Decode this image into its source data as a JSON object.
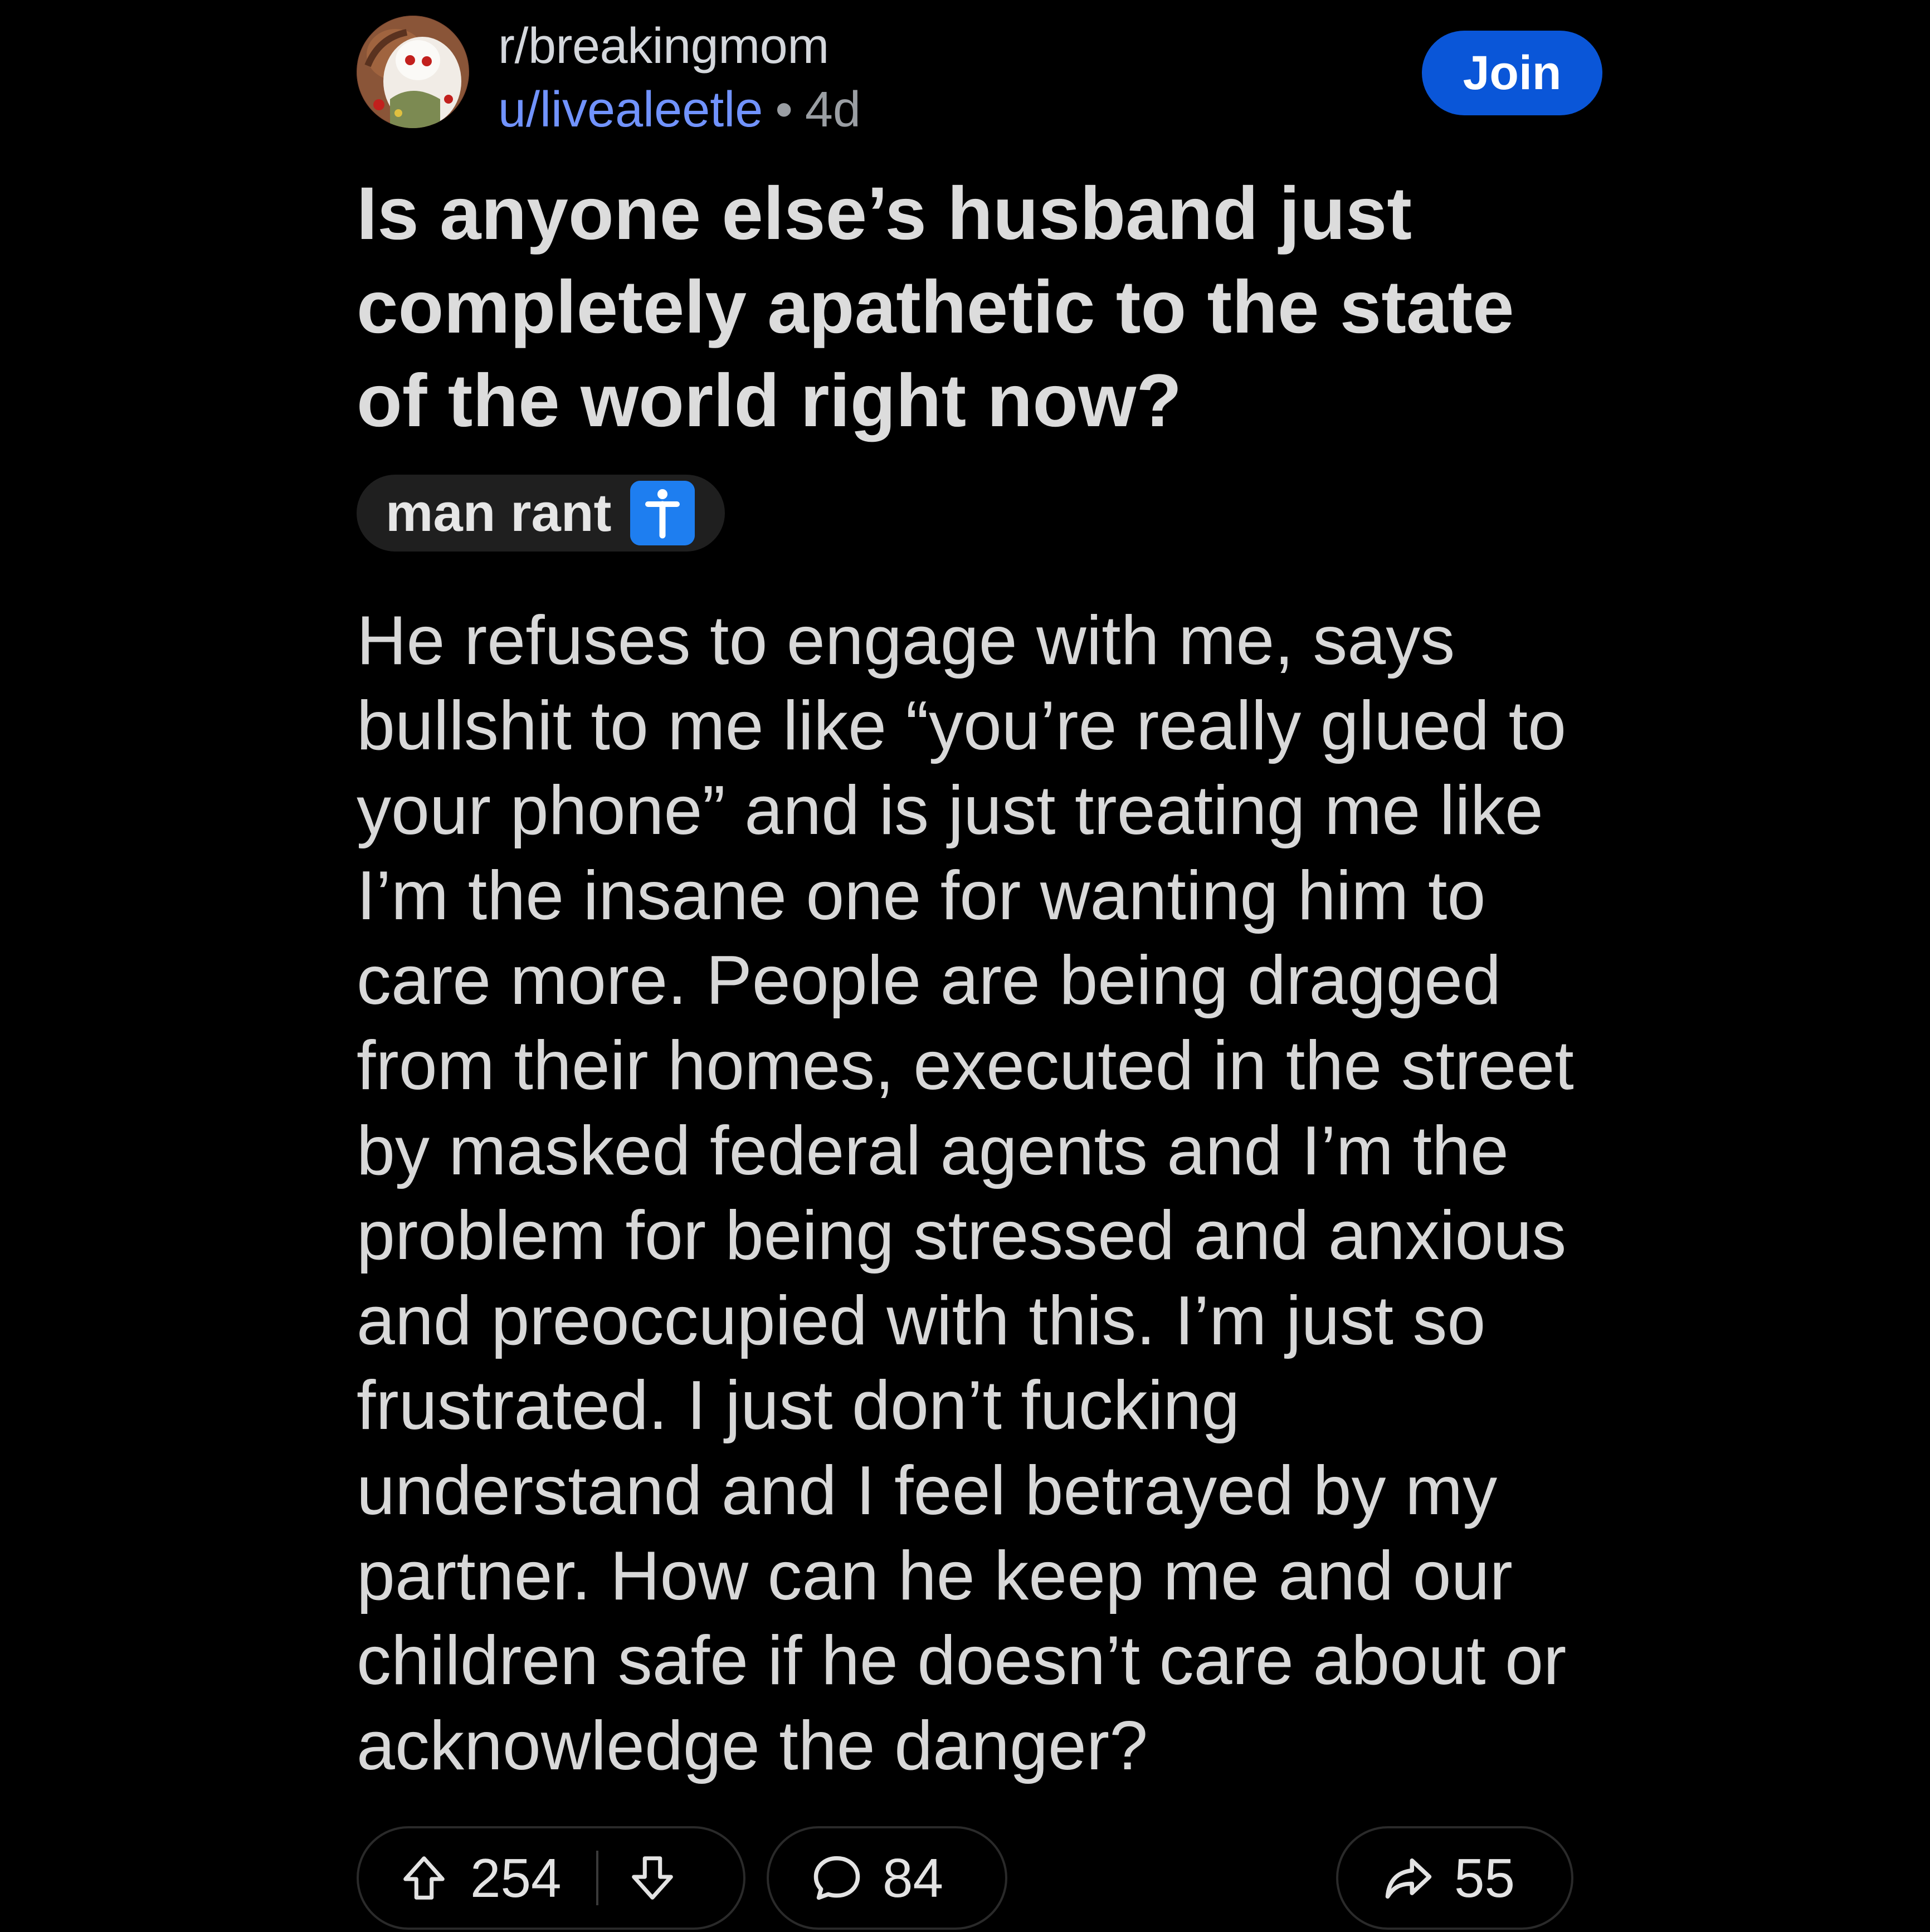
{
  "post": {
    "subreddit": "r/breakingmom",
    "author": "u/livealeetle",
    "separator": "•",
    "age": "4d",
    "join_label": "Join",
    "title": "Is anyone else’s husband just completely apathetic to the state of the world right now?",
    "flair": {
      "label": "man rant",
      "icon": "person-standing-icon"
    },
    "body": "He refuses to engage with me, says bullshit to me like “you’re really glued to your phone” and is just treating me like I’m the insane one for wanting him to care more. People are being dragged from their homes, executed in the street by masked federal agents and I’m the problem for being stressed and anxious and preoccupied with this. I’m just so frustrated. I just don’t fucking understand and I feel betrayed by my partner. How can he keep me and our children safe if he doesn’t care about or acknowledge the danger?"
  },
  "actions": {
    "upvote_icon": "arrow-up-icon",
    "score": "254",
    "downvote_icon": "arrow-down-icon",
    "comment_icon": "speech-bubble-icon",
    "comments": "84",
    "share_icon": "share-arrow-icon",
    "shares": "55"
  },
  "colors": {
    "background": "#000000",
    "join_button": "#0a56d8",
    "username": "#7193ff",
    "flair_background": "#1f1f1f",
    "flair_icon": "#1e7ef0"
  }
}
